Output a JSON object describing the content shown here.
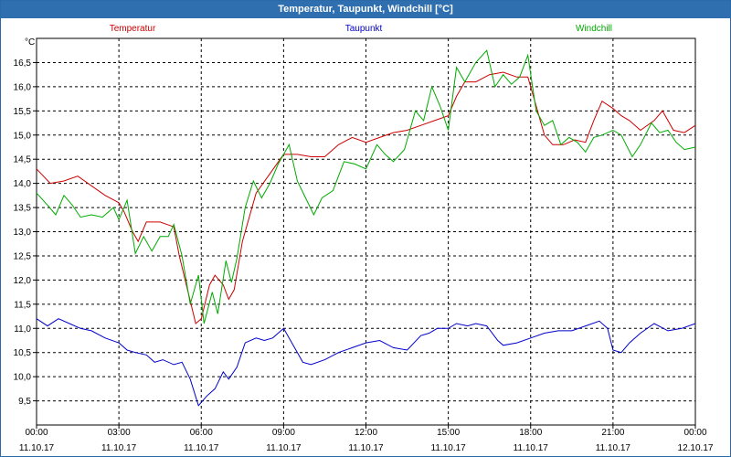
{
  "window": {
    "title": "Temperatur, Taupunkt, Windchill [°C]"
  },
  "chart_data": {
    "type": "line",
    "title": "Temperatur, Taupunkt, Windchill [°C]",
    "ylabel": "°C",
    "ylim": [
      9.0,
      17.0
    ],
    "yticks": [
      9.5,
      10.0,
      10.5,
      11.0,
      11.5,
      12.0,
      12.5,
      13.0,
      13.5,
      14.0,
      14.5,
      15.0,
      15.5,
      16.0,
      16.5
    ],
    "ytick_labels": [
      "9,5",
      "10,0",
      "10,5",
      "11,0",
      "11,5",
      "12,0",
      "12,5",
      "13,0",
      "13,5",
      "14,0",
      "14,5",
      "15,0",
      "15,5",
      "16,0",
      "16,5"
    ],
    "xlim": [
      0,
      24
    ],
    "xticks": [
      {
        "h": 0,
        "time": "00:00",
        "date": "11.10.17"
      },
      {
        "h": 3,
        "time": "03:00",
        "date": "11.10.17"
      },
      {
        "h": 6,
        "time": "06:00",
        "date": "11.10.17"
      },
      {
        "h": 9,
        "time": "09:00",
        "date": "11.10.17"
      },
      {
        "h": 12,
        "time": "12:00",
        "date": "11.10.17"
      },
      {
        "h": 15,
        "time": "15:00",
        "date": "11.10.17"
      },
      {
        "h": 18,
        "time": "18:00",
        "date": "11.10.17"
      },
      {
        "h": 21,
        "time": "21:00",
        "date": "11.10.17"
      },
      {
        "h": 24,
        "time": "00:00",
        "date": "12.10.17"
      }
    ],
    "grid": true,
    "legend_position": "top",
    "series": [
      {
        "name": "Temperatur",
        "color": "#cc0000",
        "points": [
          [
            0,
            14.3
          ],
          [
            0.5,
            14.0
          ],
          [
            1,
            14.05
          ],
          [
            1.5,
            14.15
          ],
          [
            2,
            13.95
          ],
          [
            2.5,
            13.75
          ],
          [
            3,
            13.6
          ],
          [
            3.2,
            13.4
          ],
          [
            3.5,
            13.0
          ],
          [
            3.7,
            12.8
          ],
          [
            4,
            13.2
          ],
          [
            4.5,
            13.2
          ],
          [
            5,
            13.1
          ],
          [
            5.2,
            12.5
          ],
          [
            5.5,
            11.8
          ],
          [
            5.8,
            11.1
          ],
          [
            6,
            11.2
          ],
          [
            6.3,
            11.9
          ],
          [
            6.5,
            12.1
          ],
          [
            6.8,
            11.9
          ],
          [
            7,
            11.6
          ],
          [
            7.2,
            11.8
          ],
          [
            7.5,
            12.8
          ],
          [
            8,
            13.8
          ],
          [
            8.5,
            14.2
          ],
          [
            9,
            14.6
          ],
          [
            9.5,
            14.6
          ],
          [
            10,
            14.55
          ],
          [
            10.5,
            14.55
          ],
          [
            11,
            14.8
          ],
          [
            11.5,
            14.95
          ],
          [
            12,
            14.85
          ],
          [
            12.5,
            14.95
          ],
          [
            13,
            15.05
          ],
          [
            13.5,
            15.1
          ],
          [
            14,
            15.2
          ],
          [
            14.5,
            15.3
          ],
          [
            15,
            15.4
          ],
          [
            15.3,
            15.8
          ],
          [
            15.6,
            16.1
          ],
          [
            16,
            16.1
          ],
          [
            16.5,
            16.25
          ],
          [
            17,
            16.3
          ],
          [
            17.5,
            16.2
          ],
          [
            17.9,
            16.2
          ],
          [
            18.2,
            15.6
          ],
          [
            18.5,
            15.0
          ],
          [
            18.8,
            14.8
          ],
          [
            19.2,
            14.8
          ],
          [
            19.6,
            14.9
          ],
          [
            20,
            14.85
          ],
          [
            20.3,
            15.3
          ],
          [
            20.6,
            15.7
          ],
          [
            21,
            15.55
          ],
          [
            21.3,
            15.4
          ],
          [
            21.6,
            15.3
          ],
          [
            22,
            15.1
          ],
          [
            22.5,
            15.3
          ],
          [
            22.8,
            15.5
          ],
          [
            23.2,
            15.1
          ],
          [
            23.6,
            15.05
          ],
          [
            24,
            15.2
          ]
        ]
      },
      {
        "name": "Taupunkt",
        "color": "#0000cc",
        "points": [
          [
            0,
            11.2
          ],
          [
            0.4,
            11.05
          ],
          [
            0.8,
            11.2
          ],
          [
            1.2,
            11.1
          ],
          [
            1.6,
            11.0
          ],
          [
            2,
            10.95
          ],
          [
            2.5,
            10.8
          ],
          [
            3,
            10.7
          ],
          [
            3.3,
            10.55
          ],
          [
            3.6,
            10.5
          ],
          [
            4,
            10.45
          ],
          [
            4.3,
            10.3
          ],
          [
            4.6,
            10.35
          ],
          [
            5,
            10.25
          ],
          [
            5.3,
            10.3
          ],
          [
            5.6,
            9.95
          ],
          [
            5.9,
            9.4
          ],
          [
            6.2,
            9.6
          ],
          [
            6.5,
            9.75
          ],
          [
            6.8,
            10.1
          ],
          [
            7,
            9.95
          ],
          [
            7.3,
            10.2
          ],
          [
            7.6,
            10.7
          ],
          [
            8,
            10.8
          ],
          [
            8.3,
            10.75
          ],
          [
            8.6,
            10.8
          ],
          [
            9,
            11.0
          ],
          [
            9.3,
            10.7
          ],
          [
            9.7,
            10.3
          ],
          [
            10,
            10.25
          ],
          [
            10.5,
            10.35
          ],
          [
            11,
            10.5
          ],
          [
            11.5,
            10.6
          ],
          [
            12,
            10.7
          ],
          [
            12.5,
            10.75
          ],
          [
            13,
            10.6
          ],
          [
            13.5,
            10.55
          ],
          [
            14,
            10.85
          ],
          [
            14.3,
            10.9
          ],
          [
            14.6,
            11.0
          ],
          [
            15,
            11.0
          ],
          [
            15.3,
            11.1
          ],
          [
            15.7,
            11.05
          ],
          [
            16,
            11.1
          ],
          [
            16.4,
            11.05
          ],
          [
            16.8,
            10.75
          ],
          [
            17,
            10.65
          ],
          [
            17.5,
            10.7
          ],
          [
            18,
            10.8
          ],
          [
            18.5,
            10.9
          ],
          [
            19,
            10.95
          ],
          [
            19.5,
            10.95
          ],
          [
            20,
            11.05
          ],
          [
            20.5,
            11.15
          ],
          [
            20.8,
            11.0
          ],
          [
            21,
            10.55
          ],
          [
            21.3,
            10.5
          ],
          [
            21.6,
            10.7
          ],
          [
            22,
            10.9
          ],
          [
            22.5,
            11.1
          ],
          [
            23,
            10.95
          ],
          [
            23.5,
            11.0
          ],
          [
            24,
            11.1
          ]
        ]
      },
      {
        "name": "Windchill",
        "color": "#00aa00",
        "points": [
          [
            0,
            13.8
          ],
          [
            0.4,
            13.55
          ],
          [
            0.7,
            13.35
          ],
          [
            1,
            13.75
          ],
          [
            1.3,
            13.55
          ],
          [
            1.6,
            13.3
          ],
          [
            2,
            13.35
          ],
          [
            2.4,
            13.3
          ],
          [
            2.8,
            13.5
          ],
          [
            3,
            13.25
          ],
          [
            3.3,
            13.65
          ],
          [
            3.6,
            12.55
          ],
          [
            3.9,
            12.9
          ],
          [
            4.2,
            12.6
          ],
          [
            4.5,
            12.9
          ],
          [
            4.8,
            12.9
          ],
          [
            5,
            13.15
          ],
          [
            5.3,
            12.5
          ],
          [
            5.6,
            11.5
          ],
          [
            5.9,
            12.1
          ],
          [
            6.1,
            11.1
          ],
          [
            6.4,
            11.75
          ],
          [
            6.6,
            11.3
          ],
          [
            6.9,
            12.4
          ],
          [
            7.1,
            11.95
          ],
          [
            7.3,
            12.45
          ],
          [
            7.6,
            13.5
          ],
          [
            7.9,
            14.05
          ],
          [
            8.2,
            13.7
          ],
          [
            8.5,
            14.0
          ],
          [
            8.8,
            14.4
          ],
          [
            9,
            14.6
          ],
          [
            9.2,
            14.8
          ],
          [
            9.5,
            14.05
          ],
          [
            9.8,
            13.7
          ],
          [
            10.1,
            13.35
          ],
          [
            10.4,
            13.7
          ],
          [
            10.8,
            13.85
          ],
          [
            11.2,
            14.45
          ],
          [
            11.6,
            14.4
          ],
          [
            12,
            14.3
          ],
          [
            12.4,
            14.8
          ],
          [
            12.7,
            14.6
          ],
          [
            13,
            14.45
          ],
          [
            13.4,
            14.7
          ],
          [
            13.8,
            15.5
          ],
          [
            14.1,
            15.3
          ],
          [
            14.4,
            16.0
          ],
          [
            14.7,
            15.6
          ],
          [
            15,
            15.1
          ],
          [
            15.3,
            16.4
          ],
          [
            15.6,
            16.1
          ],
          [
            16,
            16.5
          ],
          [
            16.4,
            16.75
          ],
          [
            16.7,
            16.0
          ],
          [
            17,
            16.25
          ],
          [
            17.3,
            16.05
          ],
          [
            17.6,
            16.2
          ],
          [
            17.9,
            16.65
          ],
          [
            18.2,
            15.5
          ],
          [
            18.5,
            15.2
          ],
          [
            18.8,
            15.3
          ],
          [
            19.1,
            14.8
          ],
          [
            19.4,
            14.95
          ],
          [
            19.7,
            14.85
          ],
          [
            20,
            14.65
          ],
          [
            20.3,
            14.95
          ],
          [
            20.6,
            15.0
          ],
          [
            21,
            15.1
          ],
          [
            21.3,
            15.0
          ],
          [
            21.7,
            14.55
          ],
          [
            22,
            14.8
          ],
          [
            22.4,
            15.25
          ],
          [
            22.7,
            15.05
          ],
          [
            23,
            15.1
          ],
          [
            23.3,
            14.85
          ],
          [
            23.6,
            14.7
          ],
          [
            24,
            14.75
          ]
        ]
      }
    ]
  }
}
